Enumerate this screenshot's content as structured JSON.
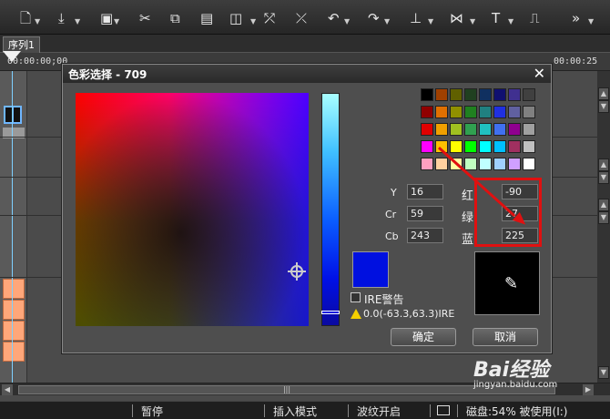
{
  "tab": {
    "label": "序列1"
  },
  "ruler": {
    "start": "00:00:00;00",
    "end": "00:00:25"
  },
  "dialog": {
    "title": "色彩选择 - 709",
    "close": "✕",
    "ycbcr": {
      "y_label": "Y",
      "y_value": "16",
      "cr_label": "Cr",
      "cr_value": "59",
      "cb_label": "Cb",
      "cb_value": "243"
    },
    "rgb": {
      "r_label": "红",
      "r_value": "-90",
      "g_label": "绿",
      "g_value": "27",
      "b_label": "蓝",
      "b_value": "225"
    },
    "ire_label": "IRE警告",
    "ire_range": "0.0(-63.3,63.3)IRE",
    "ok": "确定",
    "cancel": "取消",
    "swatches": [
      [
        "#000000",
        "#a04000",
        "#606000",
        "#204020",
        "#103060",
        "#101070",
        "#403090",
        "#404040"
      ],
      [
        "#900000",
        "#e07000",
        "#909000",
        "#208020",
        "#208080",
        "#2030e0",
        "#6060a0",
        "#808080"
      ],
      [
        "#e00000",
        "#f0a000",
        "#a0c020",
        "#30a050",
        "#20c0c0",
        "#4070f0",
        "#900090",
        "#a0a0a0"
      ],
      [
        "#ff00ff",
        "#ffc000",
        "#ffff00",
        "#00ff00",
        "#00ffff",
        "#00c0ff",
        "#a03060",
        "#c0c0c0"
      ],
      [
        "#ffa0c0",
        "#ffd0a0",
        "#ffffa0",
        "#c0ffc0",
        "#c0ffff",
        "#a0d0ff",
        "#d0a0ff",
        "#ffffff"
      ]
    ],
    "preview_color": "#0010e0"
  },
  "status": {
    "pause": "暂停",
    "insert_mode": "插入模式",
    "ripple": "波纹开启",
    "disk": "磁盘:54% 被使用(I:)"
  },
  "watermark": {
    "brand": "Bai经验",
    "url": "jingyan.baidu.com"
  }
}
